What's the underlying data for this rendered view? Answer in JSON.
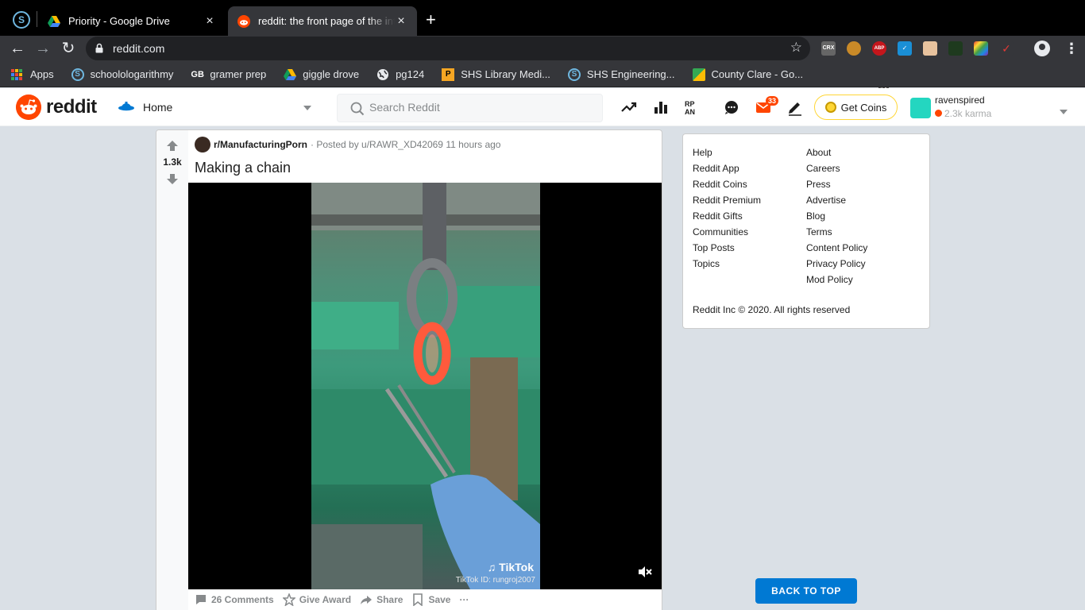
{
  "browser": {
    "tabs": [
      {
        "title": "Priority - Google Drive",
        "active": false
      },
      {
        "title": "reddit: the front page of the internet",
        "active": true
      }
    ],
    "tab_close_glyph": "×",
    "new_tab_glyph": "+",
    "url": "reddit.com",
    "bookmarks": [
      {
        "label": "Apps",
        "icon": "apps-grid-icon"
      },
      {
        "label": "schoolologarithmy",
        "icon": "schoology-icon"
      },
      {
        "label": "gramer prep",
        "icon": "gbi-icon"
      },
      {
        "label": "giggle drove",
        "icon": "google-drive-icon"
      },
      {
        "label": "pg124",
        "icon": "globe-icon"
      },
      {
        "label": "SHS Library Medi...",
        "icon": "library-icon"
      },
      {
        "label": "SHS Engineering...",
        "icon": "schoology-icon"
      },
      {
        "label": "County Clare - Go...",
        "icon": "google-maps-icon"
      }
    ],
    "extensions": [
      {
        "name": "crx-icon",
        "label": "CRX"
      },
      {
        "name": "owl-icon",
        "label": ""
      },
      {
        "name": "abp-icon",
        "label": "ABP",
        "badge": "14"
      },
      {
        "name": "checkmark-ext-icon",
        "label": ""
      },
      {
        "name": "box-ext-icon",
        "label": ""
      },
      {
        "name": "leaf-ext-icon",
        "label": ""
      },
      {
        "name": "color-ext-icon",
        "label": ""
      },
      {
        "name": "honey-ext-icon",
        "label": ""
      }
    ]
  },
  "reddit_header": {
    "wordmark": "reddit",
    "feed_label": "Home",
    "search_placeholder": "Search Reddit",
    "mail_badge": "33",
    "get_coins_label": "Get Coins",
    "username": "ravenspired",
    "karma": "2.3k karma"
  },
  "post": {
    "vote_count": "1.3k",
    "subreddit": "r/ManufacturingPorn",
    "posted_by": "· Posted by u/RAWR_XD42069 11 hours ago",
    "title": "Making a chain",
    "tiktok_label": "TikTok",
    "tiktok_id": "TikTok ID: rungroj2007",
    "actions": {
      "comments": "26 Comments",
      "give_award": "Give Award",
      "share": "Share",
      "save": "Save",
      "more": "···"
    }
  },
  "sidebar": {
    "links_left": [
      "Help",
      "Reddit App",
      "Reddit Coins",
      "Reddit Premium",
      "Reddit Gifts",
      "Communities",
      "Top Posts",
      "Topics"
    ],
    "links_right": [
      "About",
      "Careers",
      "Press",
      "Advertise",
      "Blog",
      "Terms",
      "Content Policy",
      "Privacy Policy",
      "Mod Policy"
    ],
    "copyright": "Reddit Inc © 2020. All rights reserved"
  },
  "back_to_top": "BACK TO TOP",
  "colors": {
    "reddit_orange": "#ff4500",
    "reddit_blue": "#0079d3",
    "page_bg": "#dae0e6",
    "coins_yellow": "#ffd635"
  }
}
